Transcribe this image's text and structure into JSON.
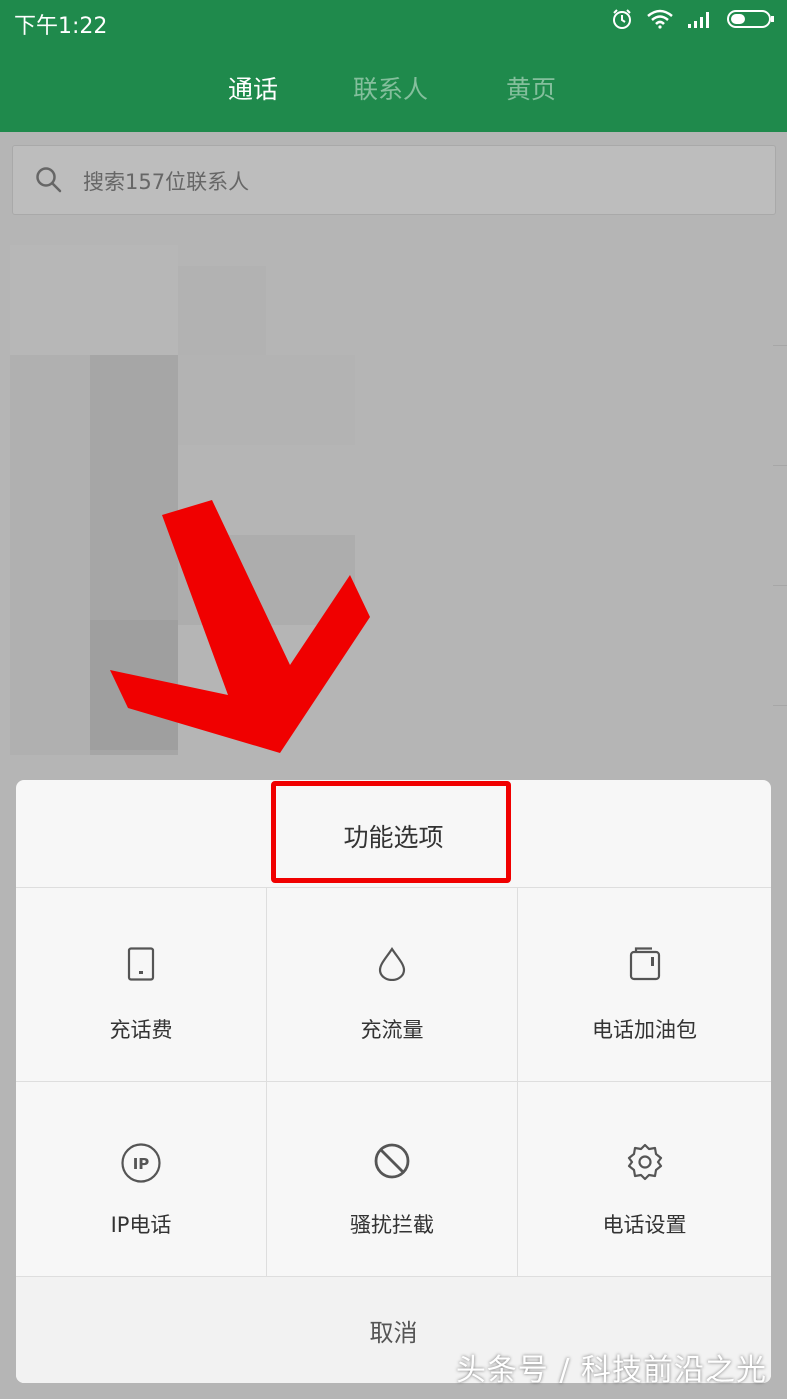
{
  "status_bar": {
    "time": "下午1:22"
  },
  "tabs": [
    {
      "label": "通话",
      "active": true
    },
    {
      "label": "联系人",
      "active": false
    },
    {
      "label": "黄页",
      "active": false
    }
  ],
  "search": {
    "placeholder": "搜索157位联系人"
  },
  "sheet": {
    "title": "功能选项",
    "options": [
      {
        "label": "充话费",
        "icon": "phone-icon"
      },
      {
        "label": "充流量",
        "icon": "droplet-icon"
      },
      {
        "label": "电话加油包",
        "icon": "sim-package-icon"
      },
      {
        "label": "IP电话",
        "icon": "ip-icon"
      },
      {
        "label": "骚扰拦截",
        "icon": "block-icon"
      },
      {
        "label": "电话设置",
        "icon": "gear-icon"
      }
    ],
    "cancel": "取消"
  },
  "watermark": "头条号 / 科技前沿之光",
  "colors": {
    "brand_green": "#1f8a4c",
    "annotation_red": "#f00000"
  }
}
